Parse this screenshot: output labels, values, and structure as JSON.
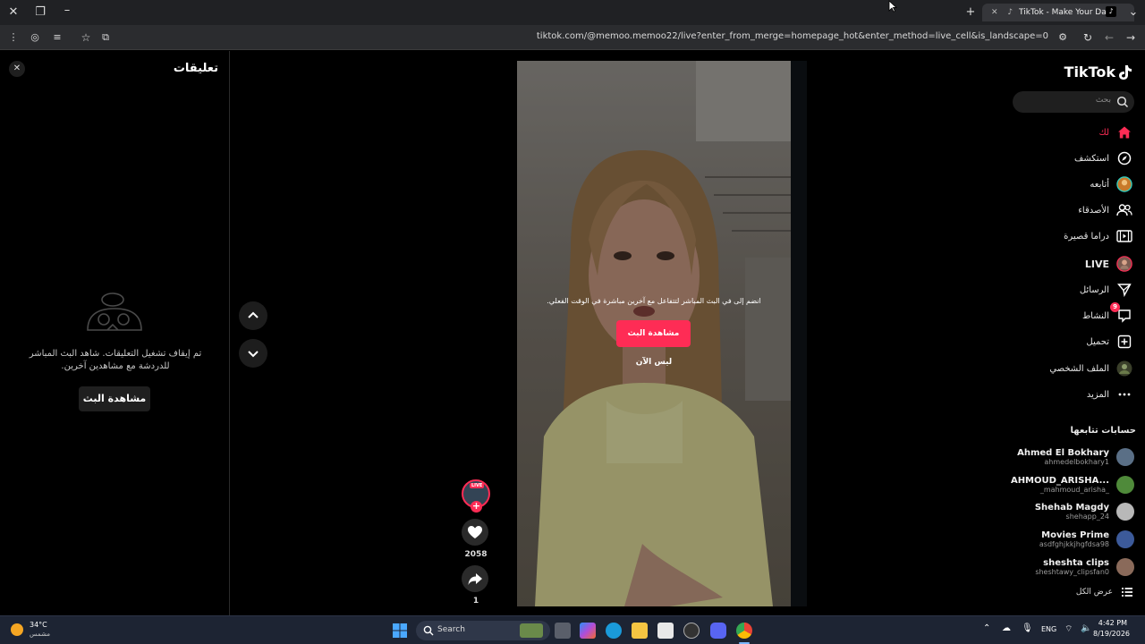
{
  "browser": {
    "tab_title": "TikTok - Make Your Day",
    "url": "tiktok.com/@memoo.memoo22/live?enter_from_merge=homepage_hot&enter_method=live_cell&is_landscape=0"
  },
  "comments": {
    "title": "تعليقات",
    "off_message": "تم إيقاف تشغيل التعليقات. شاهد البث المباشر للدردشة مع مشاهدين آخرين.",
    "watch_button": "مشاهدة البث"
  },
  "video": {
    "prompt": "انضم إلى في البث المباشر لتتفاعل مع آخرين مباشرة في الوقت الفعلي.",
    "watch_button": "مشاهدة البث",
    "not_now": "ليس الآن",
    "live_badge": "LIVE",
    "like_count": "2058",
    "share_count": "1"
  },
  "sidebar": {
    "logo": "TikTok",
    "search_placeholder": "بحث",
    "nav": [
      {
        "label": "لك",
        "icon": "home-icon",
        "active": true
      },
      {
        "label": "استكشف",
        "icon": "compass-icon"
      },
      {
        "label": "أتابعه",
        "icon": "following-avatar-icon"
      },
      {
        "label": "الأصدقاء",
        "icon": "friends-icon"
      },
      {
        "label": "دراما قصيرة",
        "icon": "drama-icon"
      },
      {
        "label": "LIVE",
        "icon": "live-icon"
      },
      {
        "label": "الرسائل",
        "icon": "send-icon"
      },
      {
        "label": "النشاط",
        "icon": "activity-icon",
        "badge": "9"
      },
      {
        "label": "تحميل",
        "icon": "upload-icon"
      },
      {
        "label": "الملف الشخصي",
        "icon": "profile-icon"
      },
      {
        "label": "المزيد",
        "icon": "more-icon"
      }
    ],
    "following_title": "حسابات تتابعها",
    "accounts": [
      {
        "name": "Ahmed El Bokhary",
        "username": "ahmedelbokhary1",
        "color": "#5a6f86"
      },
      {
        "name": "AHMOUD_ARISHA...",
        "username": "_mahmoud_arisha_",
        "color": "#4f8a3a"
      },
      {
        "name": "Shehab Magdy",
        "username": "shehapp_24",
        "color": "#b8b8b8"
      },
      {
        "name": "Movies Prime",
        "username": "asdfghjkkjhgfdsa98",
        "color": "#3c5a9a"
      },
      {
        "name": "sheshta clips",
        "username": "sheshtawy_clipsfan0",
        "color": "#8a6a5a"
      }
    ],
    "see_all": "عرض الكل"
  },
  "taskbar": {
    "weather_temp": "34°C",
    "weather_desc": "مشمس",
    "search_label": "Search",
    "language": "ENG",
    "time": "4:42 PM",
    "date": "8/19/2026"
  },
  "colors": {
    "accent": "#fe2c55"
  }
}
